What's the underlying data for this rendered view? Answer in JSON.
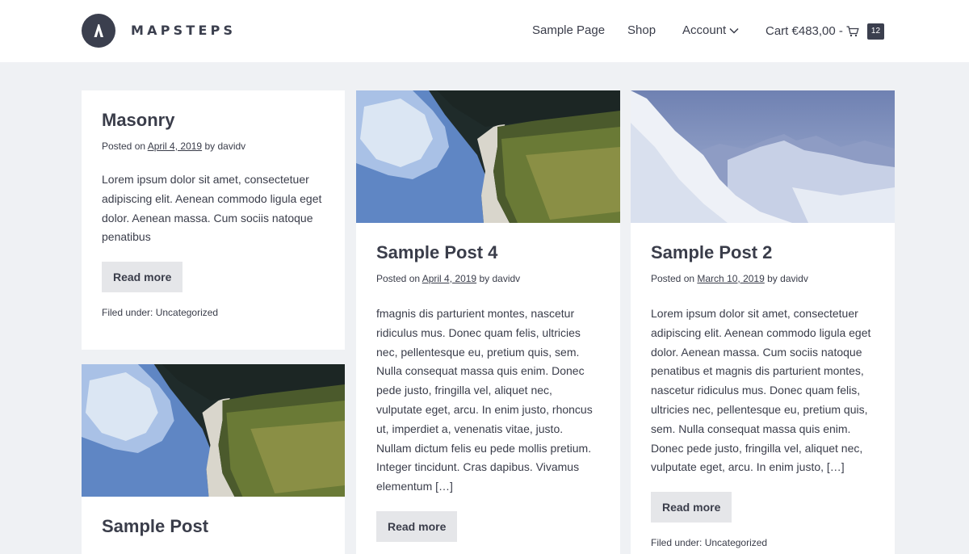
{
  "header": {
    "logo_text": "MAPSTEPS",
    "logo_mark": "Λ",
    "nav": {
      "sample_page": "Sample Page",
      "shop": "Shop",
      "account": "Account",
      "cart_label": "Cart €483,00 -",
      "cart_count": "12"
    }
  },
  "colors": {
    "accent": "#3b3f4e",
    "background": "#eff1f4",
    "button_bg": "#e5e6e9"
  },
  "posts": [
    {
      "title": "Masonry",
      "meta_prefix": "Posted on",
      "date": "April 4, 2019",
      "by": "by",
      "author": "davidv",
      "excerpt": "Lorem ipsum dolor sit amet, consectetuer adipiscing elit. Aenean commodo ligula eget dolor. Aenean massa. Cum sociis natoque penatibus",
      "read_more": "Read more",
      "filed_prefix": "Filed under:",
      "category": "Uncategorized"
    },
    {
      "title": "Sample Post 4",
      "meta_prefix": "Posted on",
      "date": "April 4, 2019",
      "by": "by",
      "author": "davidv",
      "excerpt": "fmagnis dis parturient montes, nascetur ridiculus mus. Donec quam felis, ultricies nec, pellentesque eu, pretium quis, sem. Nulla consequat massa quis enim. Donec pede justo, fringilla vel, aliquet nec, vulputate eget, arcu. In enim justo, rhoncus ut, imperdiet a, venenatis vitae, justo. Nullam dictum felis eu pede mollis pretium. Integer tincidunt. Cras dapibus. Vivamus elementum […]",
      "read_more": "Read more",
      "image": "aerial-lake-forest"
    },
    {
      "title": "Sample Post 2",
      "meta_prefix": "Posted on",
      "date": "March 10, 2019",
      "by": "by",
      "author": "davidv",
      "excerpt": "Lorem ipsum dolor sit amet, consectetuer adipiscing elit. Aenean commodo ligula eget dolor. Aenean massa. Cum sociis natoque penatibus et magnis dis parturient montes, nascetur ridiculus mus. Donec quam felis, ultricies nec, pellentesque eu, pretium quis, sem. Nulla consequat massa quis enim. Donec pede justo, fringilla vel, aliquet nec, vulputate eget, arcu. In enim justo, […]",
      "read_more": "Read more",
      "filed_prefix": "Filed under:",
      "category": "Uncategorized",
      "image": "snowy-mountains"
    },
    {
      "title": "Sample Post",
      "image": "aerial-lake-forest"
    }
  ]
}
